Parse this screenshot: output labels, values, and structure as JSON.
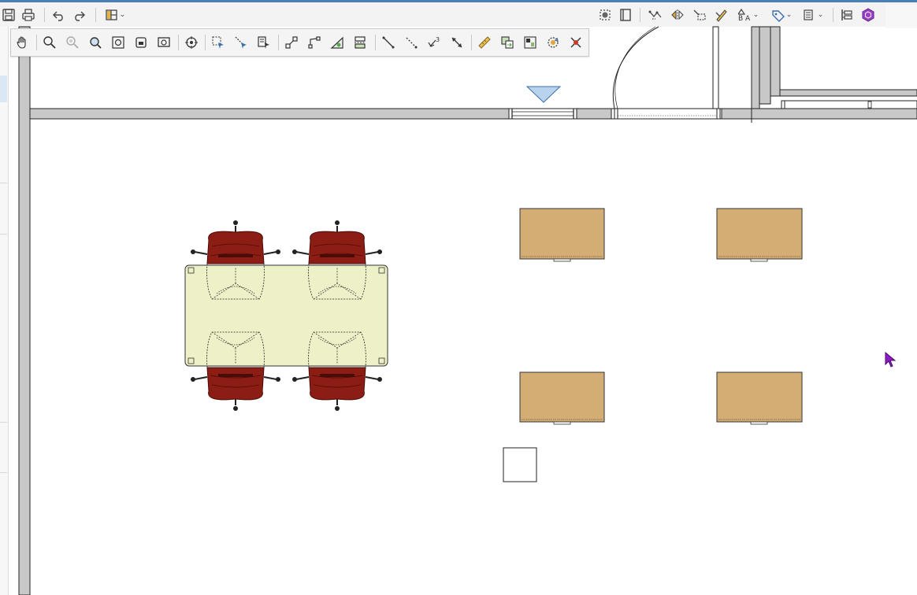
{
  "colors": {
    "accent": "#4a7fb5",
    "wall": "#c8c8c8",
    "table_fill": "#eef0c8",
    "chair": "#8b1d14",
    "desk": "#d4ad74",
    "camera_marker": "#b9d3ef",
    "cursor": "#8e1cc4"
  },
  "top_toolbar": {
    "buttons": [
      {
        "name": "save-icon"
      },
      {
        "name": "print-icon"
      },
      {
        "name": "undo-icon"
      },
      {
        "name": "redo-icon"
      },
      {
        "name": "layout-dropdown-icon"
      },
      {
        "name": "select-scene-icon"
      },
      {
        "name": "library-icon"
      },
      {
        "name": "dimension-icon"
      },
      {
        "name": "mirror-icon"
      },
      {
        "name": "reshape-icon"
      },
      {
        "name": "edit-properties-icon"
      },
      {
        "name": "text-style-icon"
      },
      {
        "name": "label-icon"
      },
      {
        "name": "list-options-icon"
      },
      {
        "name": "hierarchy-icon"
      },
      {
        "name": "3d-object-icon"
      }
    ]
  },
  "view_toolbar": {
    "buttons": [
      {
        "name": "pan-hand-icon"
      },
      {
        "name": "zoom-icon"
      },
      {
        "name": "zoom-out-icon"
      },
      {
        "name": "zoom-window-icon"
      },
      {
        "name": "fill-window-icon"
      },
      {
        "name": "zoom-selection-icon"
      },
      {
        "name": "zoom-previous-icon"
      },
      {
        "name": "center-view-icon"
      },
      {
        "name": "select-objects-icon"
      },
      {
        "name": "select-edges-icon"
      },
      {
        "name": "select-text-icon"
      },
      {
        "name": "connect-nodes-icon"
      },
      {
        "name": "break-line-icon"
      },
      {
        "name": "snap-angle-icon"
      },
      {
        "name": "align-objects-icon"
      },
      {
        "name": "draw-line-icon"
      },
      {
        "name": "dashed-line-icon"
      },
      {
        "name": "point-count-icon"
      },
      {
        "name": "measure-direction-icon"
      },
      {
        "name": "ruler-icon"
      },
      {
        "name": "copy-objects-icon"
      },
      {
        "name": "group-objects-icon"
      },
      {
        "name": "rotate-about-icon"
      },
      {
        "name": "delete-object-icon"
      }
    ],
    "point_count_label": "3"
  },
  "plan": {
    "chairs": 4,
    "conference_table": 1,
    "desks": 4,
    "tag_box": 1
  }
}
